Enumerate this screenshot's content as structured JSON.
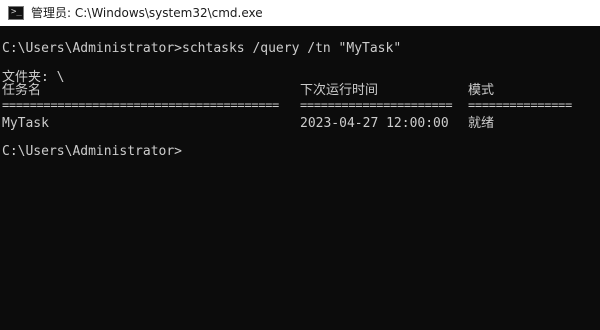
{
  "window": {
    "title": "管理员: C:\\Windows\\system32\\cmd.exe",
    "icon": "command-prompt-icon"
  },
  "console": {
    "command_line": "C:\\Users\\Administrator>schtasks /query /tn \"MyTask\"",
    "folder_line": "文件夹: \\",
    "headers": [
      "任务名",
      "下次运行时间",
      "模式"
    ],
    "separators": [
      "========================================",
      "======================",
      "==============="
    ],
    "rows": [
      [
        "MyTask",
        "2023-04-27 12:00:00",
        "就绪"
      ]
    ],
    "final_prompt": "C:\\Users\\Administrator>"
  },
  "colors": {
    "background": "#0c0c0c",
    "text": "#cccccc",
    "titlebar": "#ffffff"
  }
}
